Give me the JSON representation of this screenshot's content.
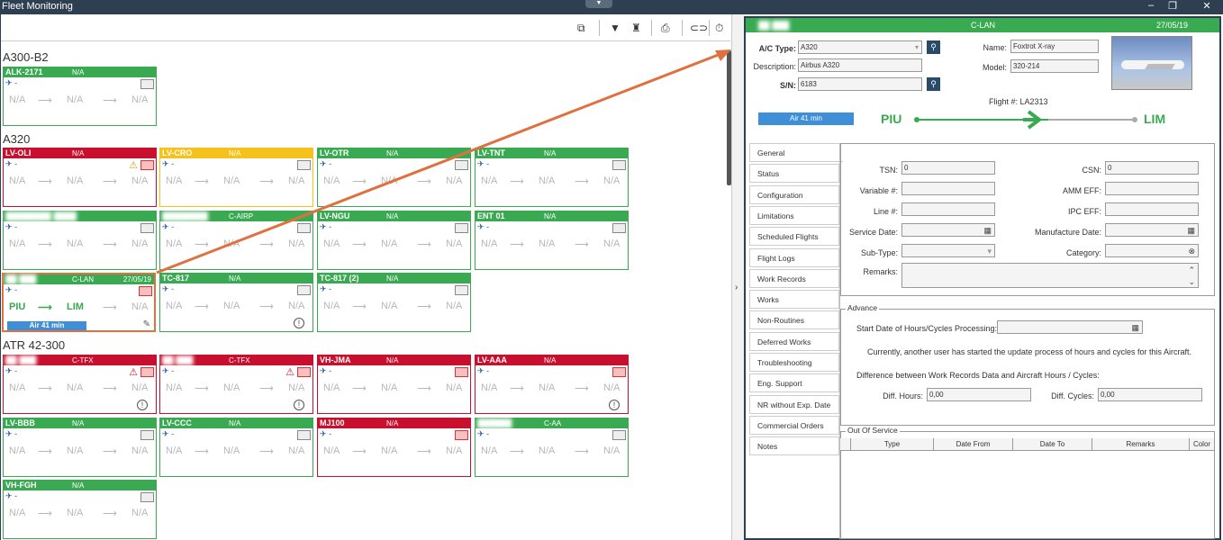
{
  "window": {
    "title": "Fleet Monitoring",
    "minimize": "–",
    "restore": "❐",
    "close": "✕",
    "drop": "▼"
  },
  "toolbar": {
    "icons": [
      "monitor-icon",
      "filter-icon",
      "binoculars-icon",
      "print-icon",
      "link-icon",
      "stopwatch-icon"
    ],
    "glyphs": [
      "⧉",
      "▼",
      "♜",
      "⎙",
      "⊂⊃",
      "⏱"
    ]
  },
  "splitter": {
    "arrow": "›"
  },
  "groups": [
    {
      "id": "g1",
      "label": "A300-B2"
    },
    {
      "id": "g2",
      "label": "A320"
    },
    {
      "id": "g3",
      "label": "ATR 42-300"
    }
  ],
  "cards": [
    {
      "id": "alk",
      "name": "ALK-2171",
      "status": "N/A",
      "color": "g",
      "blurName": false
    },
    {
      "id": "oli",
      "name": "LV-OLI",
      "status": "N/A",
      "color": "r",
      "warn": true
    },
    {
      "id": "cro",
      "name": "LV-CRO",
      "status": "N/A",
      "color": "y"
    },
    {
      "id": "otr",
      "name": "LV-OTR",
      "status": "N/A",
      "color": "g"
    },
    {
      "id": "tnt",
      "name": "LV-TNT",
      "status": "N/A",
      "color": "g"
    },
    {
      "id": "b1",
      "name": "████████ ████",
      "status": "",
      "color": "g",
      "blurName": true
    },
    {
      "id": "b2",
      "name": "████████",
      "status": "C-AIRP",
      "color": "g",
      "blurName": true
    },
    {
      "id": "ngu",
      "name": "LV-NGU",
      "status": "N/A",
      "color": "g"
    },
    {
      "id": "ent",
      "name": "ENT 01",
      "status": "N/A",
      "color": "g"
    },
    {
      "id": "sel",
      "name": "██ ███",
      "status": "C-LAN",
      "date": "27/05/19",
      "color": "g",
      "blurName": true,
      "from": "PIU",
      "to": "LIM",
      "air": "Air 41 min"
    },
    {
      "id": "tc1",
      "name": "TC-817",
      "status": "N/A",
      "color": "g"
    },
    {
      "id": "tc2",
      "name": "TC-817 (2)",
      "status": "N/A",
      "color": "g"
    },
    {
      "id": "r1",
      "name": "██ ███",
      "status": "C-TFX",
      "color": "r",
      "blurName": true
    },
    {
      "id": "r2",
      "name": "██ ███",
      "status": "C-TFX",
      "color": "r",
      "blurName": true
    },
    {
      "id": "jma",
      "name": "VH-JMA",
      "status": "N/A",
      "color": "r"
    },
    {
      "id": "aaa",
      "name": "LV-AAA",
      "status": "N/A",
      "color": "r"
    },
    {
      "id": "bbb",
      "name": "LV-BBB",
      "status": "N/A",
      "color": "g"
    },
    {
      "id": "ccc",
      "name": "LV-CCC",
      "status": "N/A",
      "color": "g"
    },
    {
      "id": "mj",
      "name": "MJ100",
      "status": "N/A",
      "color": "r"
    },
    {
      "id": "caa",
      "name": "██████",
      "status": "C-AA",
      "color": "g",
      "blurName": true
    },
    {
      "id": "fgh",
      "name": "VH-FGH",
      "status": "N/A",
      "color": "g"
    }
  ],
  "card_common": {
    "na": "N/A",
    "arrow": "⟶",
    "dash": "-",
    "plane": "✈",
    "info": "!"
  },
  "detail": {
    "header_name": "██ ███",
    "header_operator": "C-LAN",
    "header_date": "27/05/19",
    "ac_type_label": "A/C Type:",
    "ac_type": "A320",
    "desc_label": "Description:",
    "desc": "Airbus A320",
    "sn_label": "S/N:",
    "sn": "6183",
    "name_label": "Name:",
    "name": "Foxtrot X-ray",
    "model_label": "Model:",
    "model": "320-214",
    "flight": "Flight #: LA2313",
    "air": "Air 41 min",
    "from": "PIU",
    "to": "LIM",
    "search_glyph": "🔍"
  },
  "tabs": [
    "General",
    "Status",
    "Configuration",
    "Limitations",
    "Scheduled Flights",
    "Flight Logs",
    "Work Records",
    "Works",
    "Non-Routines",
    "Deferred Works",
    "Troubleshooting",
    "Eng. Support",
    "NR without Exp. Date",
    "Commercial Orders",
    "Notes"
  ],
  "general": {
    "tsn_label": "TSN:",
    "tsn": "0",
    "csn_label": "CSN:",
    "csn": "0",
    "var_label": "Variable #:",
    "amm_label": "AMM EFF:",
    "line_label": "Line #:",
    "ipc_label": "IPC EFF:",
    "svc_label": "Service Date:",
    "mfg_label": "Manufacture Date:",
    "sub_label": "Sub-Type:",
    "cat_label": "Category:",
    "rem_label": "Remarks:"
  },
  "advance": {
    "legend": "Advance",
    "start_label": "Start Date of Hours/Cycles Processing:",
    "msg": "Currently, another user has started the update process of hours and cycles for this Aircraft.",
    "diff_msg": "Difference between Work Records Data and Aircraft Hours / Cycles:",
    "hours_label": "Diff. Hours:",
    "hours": "0,00",
    "cycles_label": "Diff. Cycles:",
    "cycles": "0,00"
  },
  "oos": {
    "legend": "Out Of Service",
    "cols": [
      "Type",
      "Date From",
      "Date To",
      "Remarks",
      "Color"
    ]
  },
  "colors": {
    "green": "#3aaa52",
    "red": "#c8102e",
    "yellow": "#f5c21b",
    "blue": "#3f8fd8",
    "arrow": "#e07040"
  }
}
